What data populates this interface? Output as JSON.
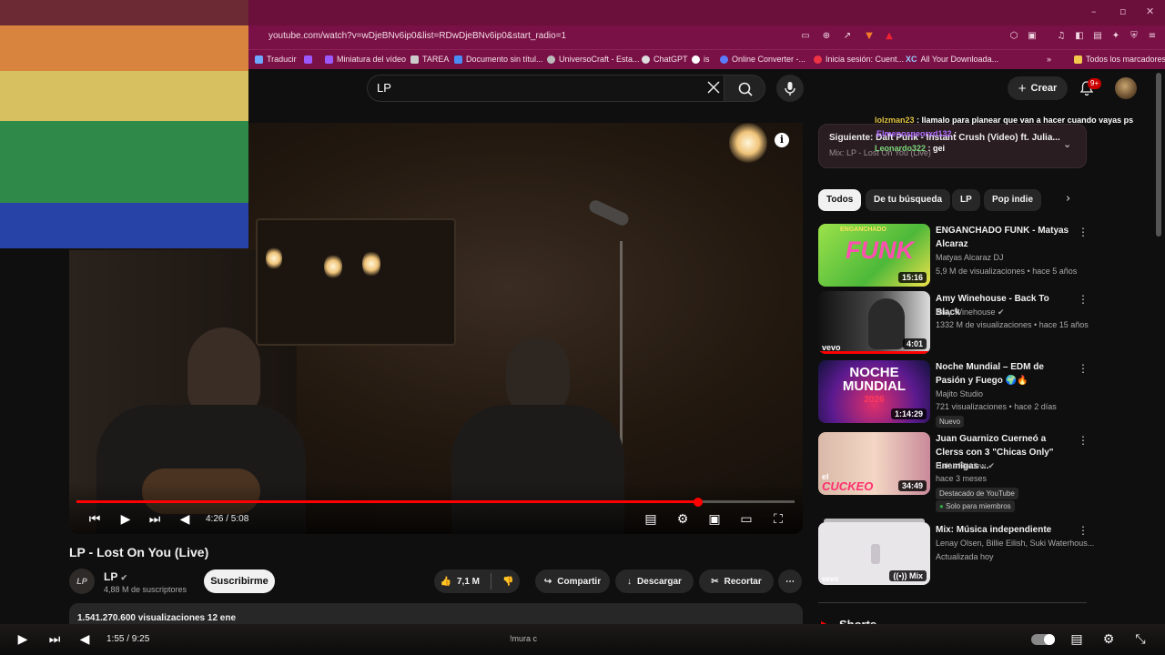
{
  "browser": {
    "url": "youtube.com/watch?v=wDjeBNv6ip0&list=RDwDjeBNv6ip0&start_radio=1",
    "bookmarks": [
      "Traducir",
      "Miniatura del vídeo",
      "TAREA",
      "Documento sin títul...",
      "UniversoCraft - Esta...",
      "ChatGPT",
      "is",
      "Online Converter -...",
      "Inicia sesión: Cuent...",
      "All Your Downloada..."
    ],
    "bookmarks_more": "»",
    "all_bookmarks": "Todos los marcadores"
  },
  "header": {
    "search_value": "LP",
    "create_label": "Crear",
    "notif_count": "9+"
  },
  "player": {
    "time": "4:26 / 5:08",
    "progress_fraction": 0.866
  },
  "video": {
    "title": "LP - Lost On You (Live)",
    "channel": "LP",
    "channel_avatar_text": "LP",
    "subscribers": "4,88 M de suscriptores",
    "subscribe_label": "Suscribirme",
    "likes": "7,1 M",
    "share_label": "Compartir",
    "download_label": "Descargar",
    "clip_label": "Recortar",
    "more_label": "⋯",
    "views_date": "1.541.270.600 visualizaciones  12 ene"
  },
  "next_up": {
    "title": "Siguiente: Daft Punk - Instant Crush (Video) ft. Julia...",
    "subtitle": "Mix: LP - Lost On You (Live)"
  },
  "chat": [
    {
      "user": "lolzman23",
      "msg": ": llamalo para planear que van a hacer cuando vayas ps"
    },
    {
      "user": "Elmenospeorxd132",
      "msg": ":"
    },
    {
      "user": "Leonardo322",
      "msg": ": gei"
    }
  ],
  "chips": [
    "Todos",
    "De tu búsqueda",
    "LP",
    "Pop indie"
  ],
  "recommendations": [
    {
      "title": "ENGANCHADO FUNK - Matyas Alcaraz",
      "channel": "Matyas Alcaraz DJ",
      "meta": "5,9 M de visualizaciones • hace 5 años",
      "duration": "15:16"
    },
    {
      "title": "Amy Winehouse - Back To Black",
      "channel": "Amy Winehouse",
      "meta": "1332 M de visualizaciones • hace 15 años",
      "duration": "4:01"
    },
    {
      "title": "Noche Mundial – EDM de Pasión y Fuego 🌍🔥",
      "channel": "Majito Studio",
      "meta": "721 visualizaciones • hace 2 días",
      "duration": "1:14:29",
      "badge": "Nuevo"
    },
    {
      "title": "Juan Guarnizo Cuerneó a Clerss con 3 \"Chicas Only\" Enemigas ...",
      "channel": "Dalas Review",
      "meta": "hace 3 meses",
      "duration": "34:49",
      "badge": "Destacado de YouTube",
      "badge2": "Solo para miembros"
    },
    {
      "title": "Mix: Música independiente",
      "channel": "Lenay Olsen, Billie Eilish, Suki Waterhous...",
      "meta": "Actualizada hoy",
      "duration": "Mix"
    }
  ],
  "shorts_label": "Shorts",
  "bottom_player": {
    "time": "1:55 / 9:25",
    "caption": "!mura c"
  },
  "thumb_text": {
    "funk": "FUNK",
    "noche1": "NOCHE",
    "noche2": "MUNDIAL",
    "noche3": "2026",
    "vevo": "vevo",
    "el": "el",
    "coca": "CUCKEO",
    "mini": "ENGANCHADO"
  },
  "colors": {
    "browser": "#7a1146",
    "accent": "#ff0000",
    "bg": "#0f0f0f"
  }
}
